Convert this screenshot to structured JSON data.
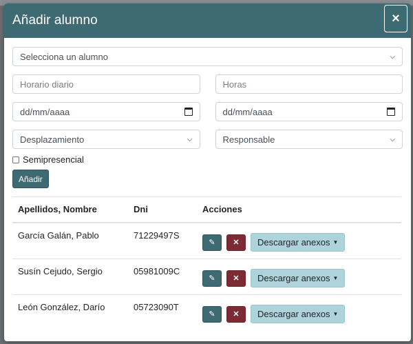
{
  "modal": {
    "title": "Añadir alumno",
    "close_icon": "×"
  },
  "form": {
    "student_select": "Selecciona un alumno",
    "horario_placeholder": "Horario diario",
    "horas_placeholder": "Horas",
    "fecha_inicio": "dd/mm/aaaa",
    "fecha_fin": "dd/mm/aaaa",
    "desplazamiento_select": "Desplazamiento",
    "responsable_select": "Responsable",
    "semipresencial_label": "Semipresencial",
    "semipresencial_checked": false,
    "add_button": "Añadir"
  },
  "table": {
    "headers": [
      "Apellidos, Nombre",
      "Dni",
      "Acciones"
    ],
    "rows": [
      {
        "name": "García Galán, Pablo",
        "dni": "71229497S"
      },
      {
        "name": "Susín Cejudo, Sergio",
        "dni": "05981009C"
      },
      {
        "name": "León González, Darío",
        "dni": "05723090T"
      }
    ],
    "download_label": "Descargar anexos",
    "edit_icon": "edit-icon",
    "delete_icon": "close-icon"
  },
  "colors": {
    "primary": "#3e6b73",
    "danger": "#7d2a33",
    "info_light": "#aed3da"
  }
}
